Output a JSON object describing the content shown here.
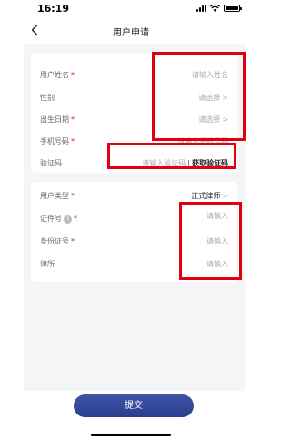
{
  "status_bar": {
    "time": "16:19"
  },
  "header": {
    "title": "用户申请",
    "back_icon": "chevron-left-icon"
  },
  "form_main": {
    "rows": [
      {
        "label": "用户姓名",
        "required": "*",
        "placeholder": "请输入姓名"
      },
      {
        "label": "性别",
        "required": "",
        "placeholder": "请选择",
        "chevron": ">"
      },
      {
        "label": "出生日期",
        "required": "*",
        "placeholder": "请选择",
        "chevron": ">"
      },
      {
        "label": "手机号码",
        "required": "*",
        "placeholder": "请输入手机号码"
      },
      {
        "label": "验证码",
        "required": "",
        "placeholder": "请输入验证码",
        "separator": "|",
        "action": "获取验证码"
      }
    ]
  },
  "form_extra": {
    "rows": [
      {
        "label": "用户类型",
        "required": "*",
        "value": "正式律师",
        "chevron": ">"
      },
      {
        "label": "证件号",
        "help": "?",
        "required": "*",
        "placeholder": "请输入"
      },
      {
        "label": "身份证号",
        "required": "*",
        "placeholder": "请输入"
      },
      {
        "label": "律所",
        "required": "",
        "placeholder": "请输入"
      }
    ]
  },
  "submit": {
    "label": "提交"
  },
  "colors": {
    "accent": "#2f4596",
    "required": "#e02020",
    "highlight_box": "#e00012",
    "background": "#f4f5f7"
  }
}
